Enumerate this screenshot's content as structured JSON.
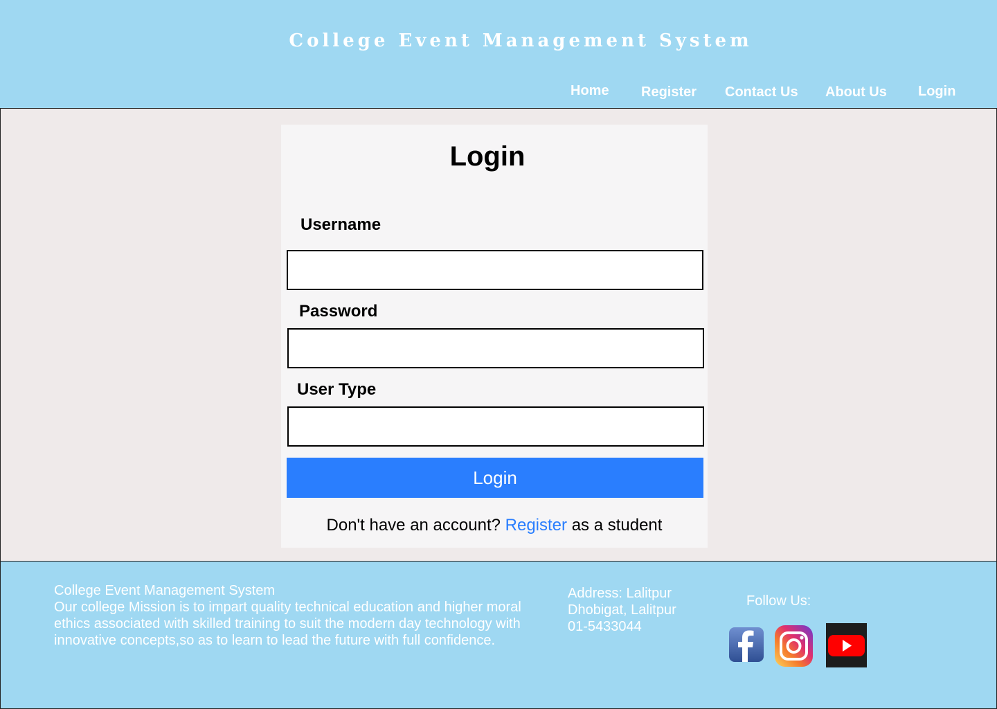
{
  "header": {
    "title": "College Event Management System",
    "nav": [
      "Home",
      "Register",
      "Contact Us",
      "About Us",
      "Login"
    ]
  },
  "login_form": {
    "title": "Login",
    "username_label": "Username",
    "username_value": "",
    "password_label": "Password",
    "password_value": "",
    "usertype_label": "User Type",
    "usertype_value": "",
    "submit_label": "Login",
    "register_prefix": "Don't have an account?",
    "register_link": "Register",
    "register_suffix": "as a student"
  },
  "footer": {
    "about_title": "College Event Management System",
    "about_text": "Our college Mission is to impart quality technical education and higher moral ethics associated with skilled training to suit the modern day technology with innovative concepts,so as to learn to lead the future with full confidence.",
    "address_line1": "Address: Lalitpur",
    "address_line2": "Dhobigat, Lalitpur",
    "phone": "01-5433044",
    "follow_label": "Follow Us:",
    "social_icons": [
      "facebook-icon",
      "instagram-icon",
      "youtube-icon"
    ]
  },
  "colors": {
    "header_bg": "#9fd8f2",
    "page_bg": "#efeaea",
    "card_bg": "#f6f5f6",
    "button_bg": "#2a7efe",
    "link": "#2a7efe"
  }
}
